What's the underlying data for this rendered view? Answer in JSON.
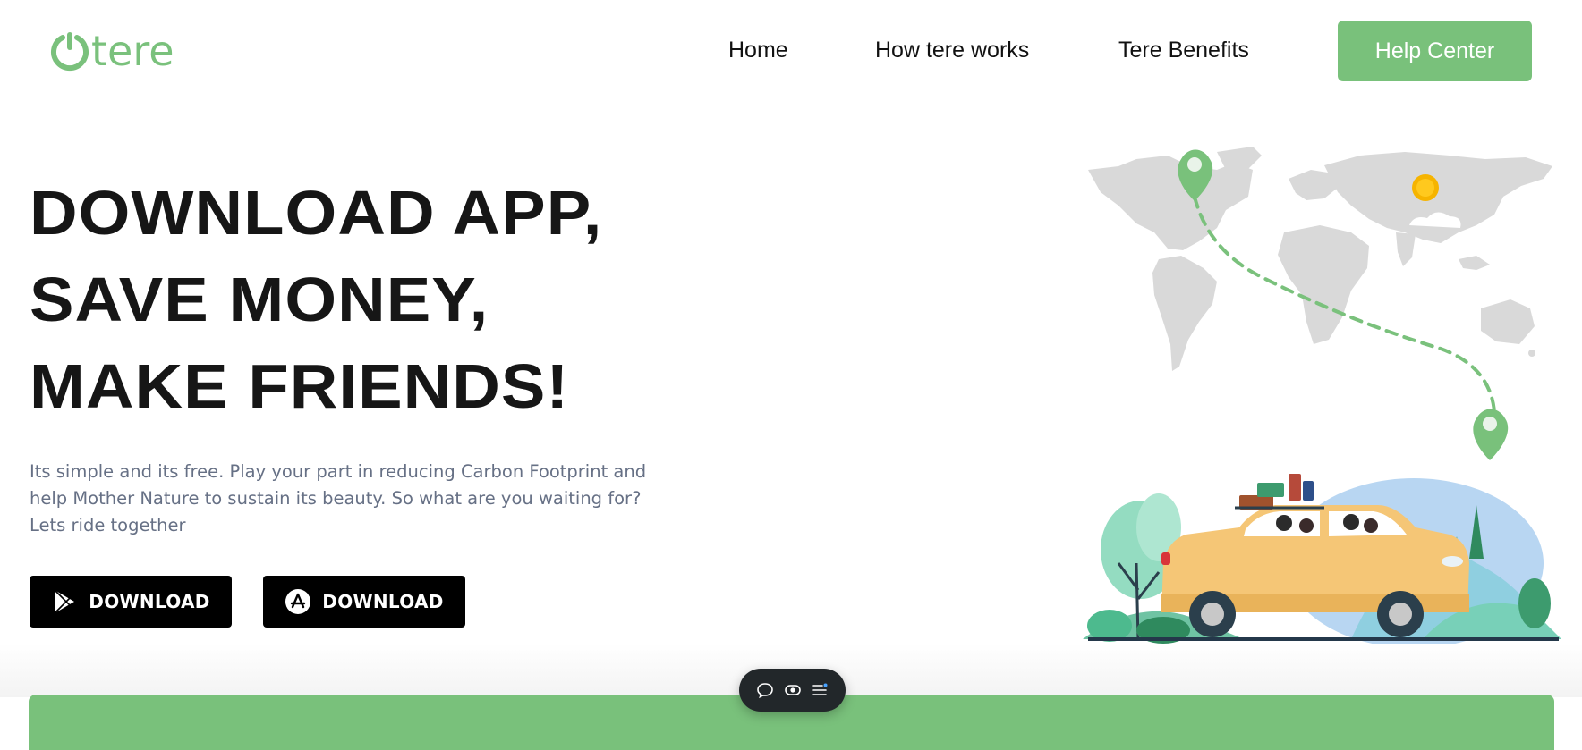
{
  "brand": {
    "name": "tere",
    "color": "#7ac17c"
  },
  "nav": {
    "home": "Home",
    "how_it_works": "How tere works",
    "benefits": "Tere Benefits",
    "help_center": "Help Center"
  },
  "hero": {
    "line1": "DOWNLOAD APP,",
    "line2": "SAVE MONEY,",
    "line3": "MAKE FRIENDS!",
    "description": "Its simple and its free. Play your part in reducing Carbon Footprint and help Mother Nature to sustain its beauty. So what are you waiting for? Lets ride together"
  },
  "downloads": {
    "play_store": {
      "label": "DOWNLOAD",
      "icon": "google-play-icon"
    },
    "app_store": {
      "label": "DOWNLOAD",
      "icon": "app-store-icon"
    }
  },
  "floating_toolbar": {
    "icons": [
      "chat-bubble-icon",
      "toggle-view-icon",
      "menu-icon"
    ]
  },
  "colors": {
    "accent": "#79c17b",
    "text_dark": "#161616",
    "text_muted": "#667085",
    "button_dark": "#000000",
    "toolbar_bg": "#22272a"
  }
}
